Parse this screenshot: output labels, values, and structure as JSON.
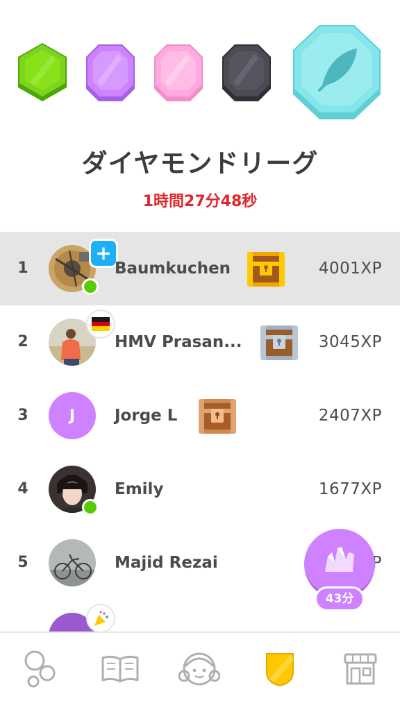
{
  "league": {
    "title": "ダイヤモンドリーグ",
    "time_remaining": "1時間27分48秒",
    "badges": [
      {
        "name": "emerald",
        "color": "#58cc02"
      },
      {
        "name": "amethyst",
        "color": "#ce82ff"
      },
      {
        "name": "pearl",
        "color": "#ffaadf"
      },
      {
        "name": "obsidian",
        "color": "#4b4b55"
      },
      {
        "name": "diamond",
        "color": "#84e6ea"
      }
    ]
  },
  "leaderboard": [
    {
      "rank": "1",
      "name": "Baumkuchen",
      "xp": "4001XP",
      "highlighted": true,
      "online": true,
      "badge": "plus-icon",
      "chest": "gold-chest-icon"
    },
    {
      "rank": "2",
      "name": "HMV Prasan...",
      "xp": "3045XP",
      "highlighted": false,
      "online": false,
      "badge": "germany-flag-icon",
      "chest": "silver-chest-icon"
    },
    {
      "rank": "3",
      "name": "Jorge L",
      "xp": "2407XP",
      "highlighted": false,
      "online": false,
      "avatar_letter": "J",
      "chest": "bronze-chest-icon"
    },
    {
      "rank": "4",
      "name": "Emily",
      "xp": "1677XP",
      "highlighted": false,
      "online": true
    },
    {
      "rank": "5",
      "name": "Majid Rezai",
      "xp": "XP",
      "highlighted": false,
      "online": false
    },
    {
      "rank": "",
      "name": "",
      "xp": "",
      "badge": "party-popper-icon"
    }
  ],
  "floating_button": {
    "label": "43分",
    "icon": "xp-boost-icon"
  },
  "bottom_nav": [
    {
      "name": "learn-tab",
      "icon": "bubbles-icon",
      "active": false
    },
    {
      "name": "stories-tab",
      "icon": "book-icon",
      "active": false
    },
    {
      "name": "profile-tab",
      "icon": "face-icon",
      "active": false
    },
    {
      "name": "leagues-tab",
      "icon": "shield-icon",
      "active": true
    },
    {
      "name": "shop-tab",
      "icon": "shop-icon",
      "active": false
    }
  ],
  "colors": {
    "highlight_row": "#e5e5e5",
    "timer": "#e0262b",
    "online": "#58cc02",
    "fab": "#ce82ff"
  }
}
